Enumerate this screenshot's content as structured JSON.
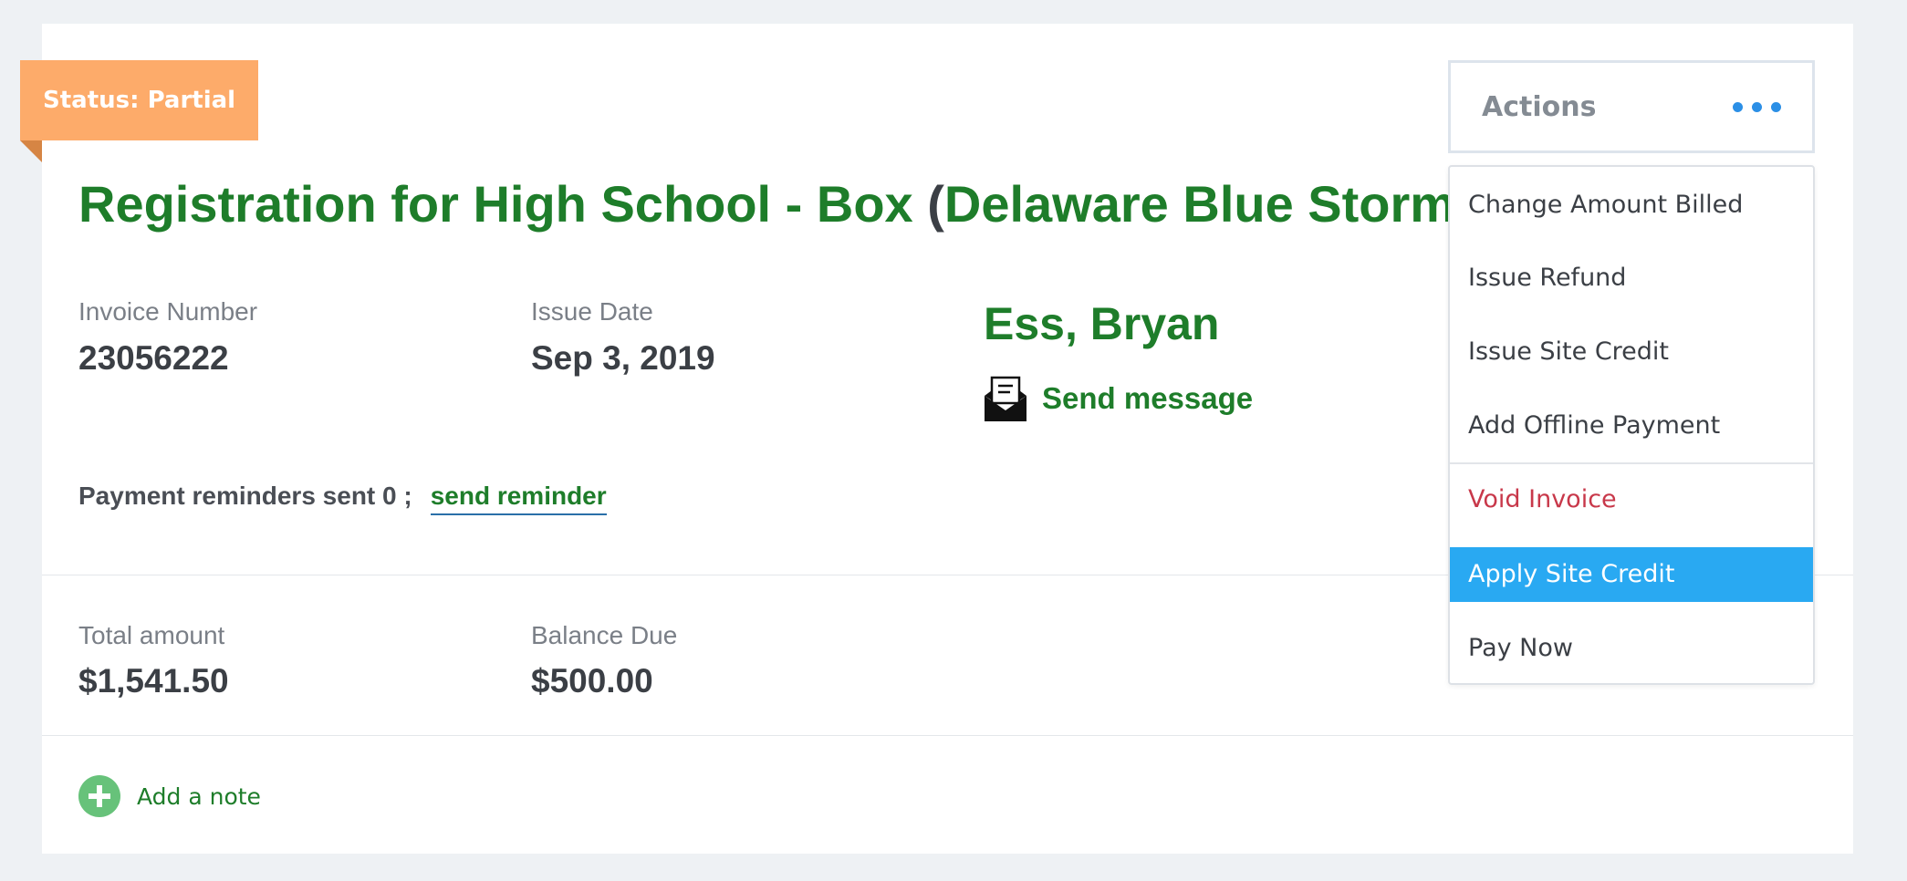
{
  "status": {
    "label": "Status: Partial"
  },
  "title": {
    "main": "Registration for High School - Box ",
    "open_paren": "(",
    "team": "Delaware Blue Storm",
    "close_paren": ")"
  },
  "invoice": {
    "number_label": "Invoice Number",
    "number": "23056222",
    "date_label": "Issue Date",
    "date": "Sep 3, 2019"
  },
  "customer": {
    "name": "Ess, Bryan",
    "message_label": "Send message",
    "message_icon": "envelope-icon"
  },
  "reminders": {
    "text": "Payment reminders sent 0 ;",
    "link_label": "send reminder"
  },
  "totals": {
    "total_label": "Total amount",
    "total": "$1,541.50",
    "balance_label": "Balance Due",
    "balance": "$500.00"
  },
  "note": {
    "label": "Add a note",
    "icon": "plus-circle-icon"
  },
  "actions": {
    "label": "Actions",
    "icon": "more-dots-icon",
    "menu": {
      "change_amount": "Change Amount Billed",
      "issue_refund": "Issue Refund",
      "issue_site_credit": "Issue Site Credit",
      "add_offline_payment": "Add Offline Payment",
      "void_invoice": "Void Invoice",
      "apply_site_credit": "Apply Site Credit",
      "pay_now": "Pay Now"
    }
  },
  "colors": {
    "brand_green": "#1e7d2a",
    "status_orange": "#fdab6a",
    "highlight_blue": "#29a9f2",
    "danger_red": "#c8384a",
    "accent_blue": "#2b8fe6"
  }
}
